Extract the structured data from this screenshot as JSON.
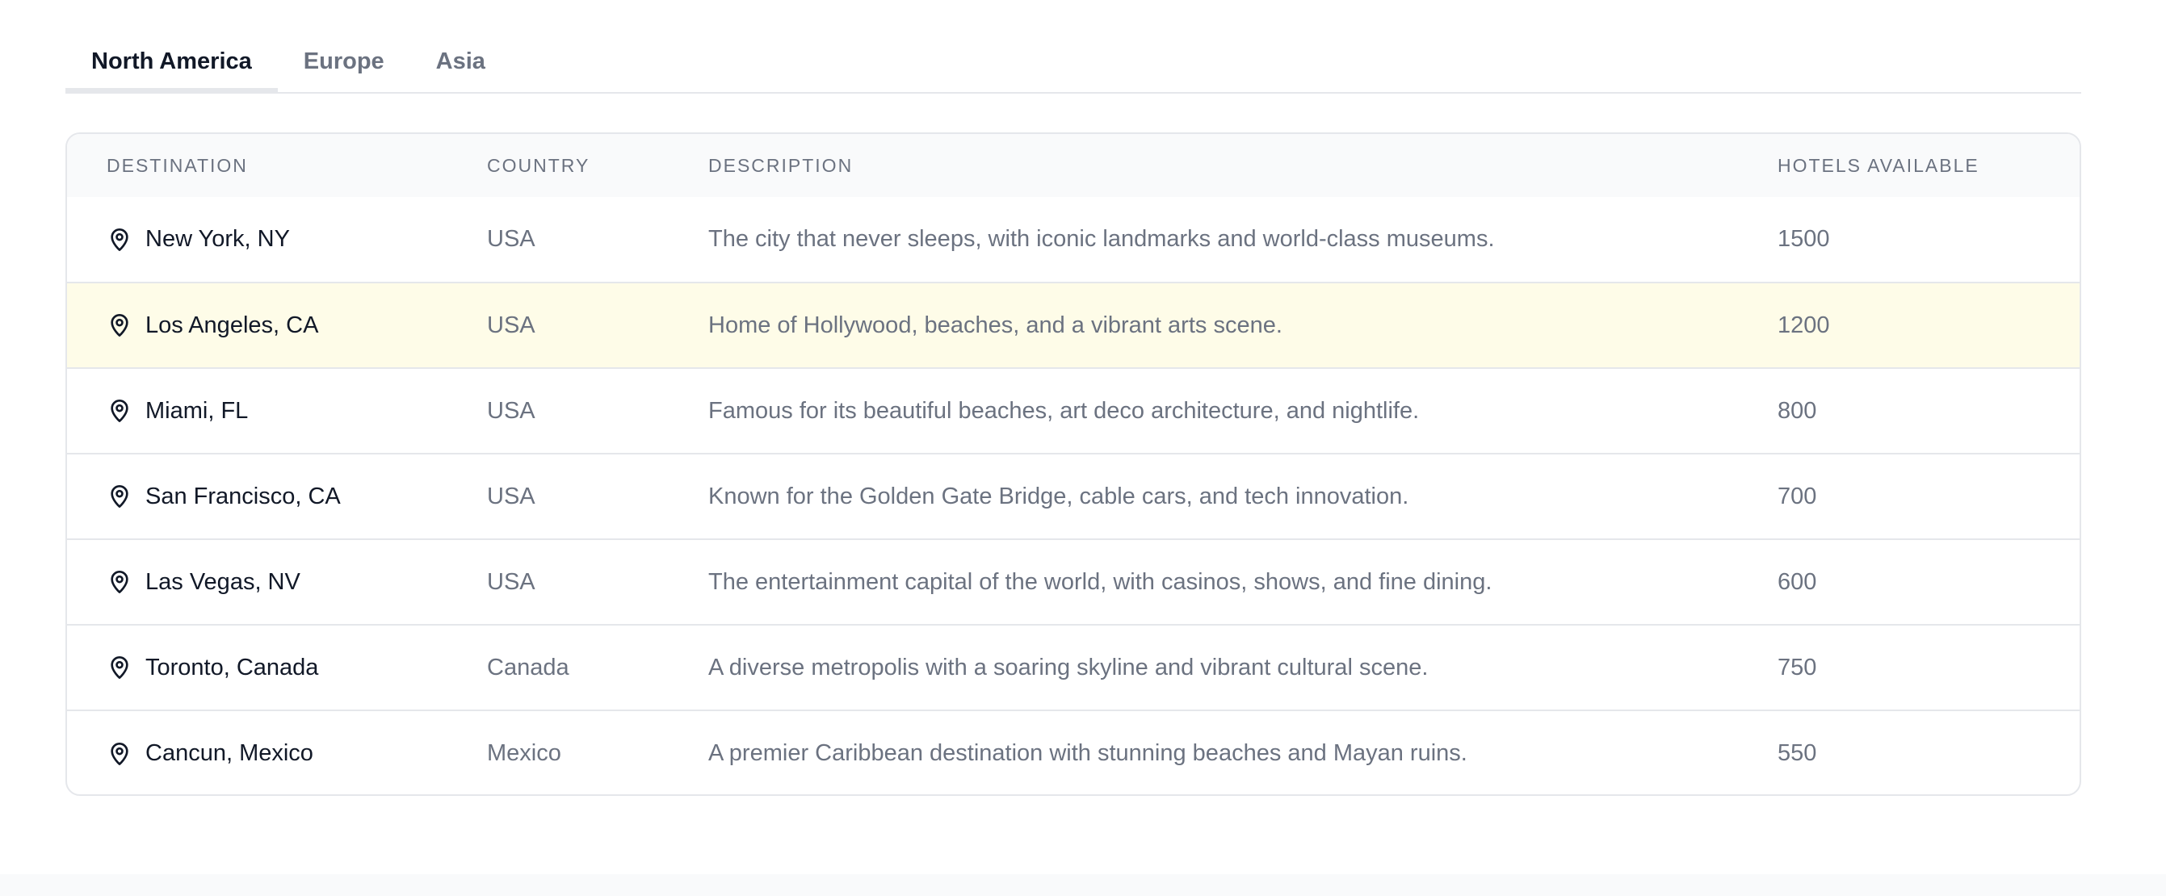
{
  "tabs": [
    {
      "label": "North America",
      "active": true
    },
    {
      "label": "Europe",
      "active": false
    },
    {
      "label": "Asia",
      "active": false
    }
  ],
  "table": {
    "headers": {
      "destination": "DESTINATION",
      "country": "COUNTRY",
      "description": "DESCRIPTION",
      "hotels": "HOTELS AVAILABLE"
    },
    "rows": [
      {
        "destination": "New York, NY",
        "country": "USA",
        "description": "The city that never sleeps, with iconic landmarks and world-class museums.",
        "hotels": "1500",
        "icon": "map-pin-icon"
      },
      {
        "destination": "Los Angeles, CA",
        "country": "USA",
        "description": "Home of Hollywood, beaches, and a vibrant arts scene.",
        "hotels": "1200",
        "icon": "map-pin-icon"
      },
      {
        "destination": "Miami, FL",
        "country": "USA",
        "description": "Famous for its beautiful beaches, art deco architecture, and nightlife.",
        "hotels": "800",
        "icon": "map-pin-icon"
      },
      {
        "destination": "San Francisco, CA",
        "country": "USA",
        "description": "Known for the Golden Gate Bridge, cable cars, and tech innovation.",
        "hotels": "700",
        "icon": "map-pin-icon"
      },
      {
        "destination": "Las Vegas, NV",
        "country": "USA",
        "description": "The entertainment capital of the world, with casinos, shows, and fine dining.",
        "hotels": "600",
        "icon": "map-pin-icon"
      },
      {
        "destination": "Toronto, Canada",
        "country": "Canada",
        "description": "A diverse metropolis with a soaring skyline and vibrant cultural scene.",
        "hotels": "750",
        "icon": "map-pin-icon"
      },
      {
        "destination": "Cancun, Mexico",
        "country": "Mexico",
        "description": "A premier Caribbean destination with stunning beaches and Mayan ruins.",
        "hotels": "550",
        "icon": "map-pin-icon"
      }
    ],
    "highlighted_row": 1
  },
  "colors": {
    "highlight_row_bg": "#fefce8",
    "header_bg": "#f9fafb",
    "border": "#e5e7eb",
    "muted_text": "#6b7280",
    "primary_text": "#111827"
  }
}
